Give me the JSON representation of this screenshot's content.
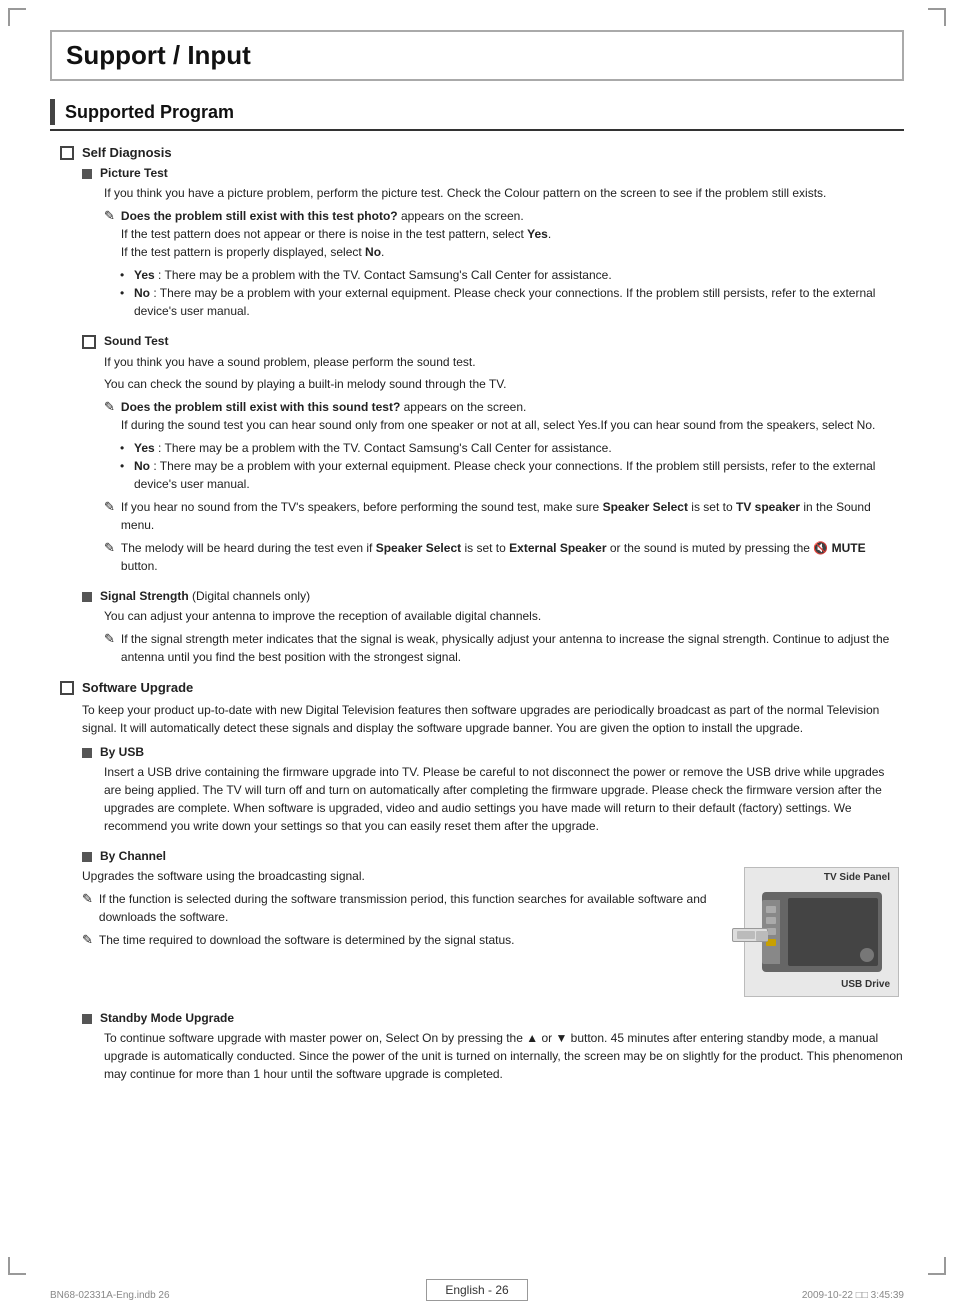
{
  "page": {
    "main_title": "Support / Input",
    "section_title": "Supported Program",
    "footer_page": "English - 26",
    "footer_left": "BN68-02331A-Eng.indb   26",
    "footer_right": "2009-10-22   □□ 3:45:39"
  },
  "self_diagnosis": {
    "heading": "Self Diagnosis",
    "picture_test": {
      "title": "Picture Test",
      "body": "If you think you have a picture problem, perform the picture test. Check the Colour pattern on the screen to see if the problem still exists.",
      "note1": {
        "bold": "Does the problem still exist with this test photo?",
        "text": " appears on the screen.\nIf the test pattern does not appear or there is noise in the test pattern, select Yes.\nIf the test pattern is properly displayed, select No."
      },
      "bullets": [
        {
          "label": "Yes",
          "text": ": There may be a problem with the TV. Contact Samsung's Call Center for assistance."
        },
        {
          "label": "No",
          "text": ": There may be a problem with your external equipment. Please check your connections. If the problem still persists, refer to the external device's user manual."
        }
      ]
    },
    "sound_test": {
      "title": "Sound Test",
      "body1": "If you think you have a sound problem, please perform the sound test.",
      "body2": "You can check the sound by playing a built-in melody sound through the TV.",
      "note1": {
        "bold": "Does the problem still exist with this sound test?",
        "text": " appears on the screen.\nIf during the sound test you can hear sound only from one speaker or not at all, select Yes.If you can hear sound from the speakers, select No."
      },
      "bullets": [
        {
          "label": "Yes",
          "text": ": There may be a problem with the TV. Contact Samsung's Call Center for assistance."
        },
        {
          "label": "No",
          "text": ": There may be a problem with your external equipment. Please check your connections. If the problem still persists, refer to the external device's user manual."
        }
      ],
      "note2": "If you hear no sound from the TV's speakers, before performing the sound test, make sure <b>Speaker Select</b> is set to <b>TV speaker</b> in the Sound menu.",
      "note3": "The melody will be heard during the test even if <b>Speaker Select</b> is set to <b>External Speaker</b> or the sound is muted by pressing the 🔇 <b>MUTE</b> button."
    },
    "signal_strength": {
      "title": "Signal Strength",
      "title_note": "(Digital channels only)",
      "body": "You can adjust your antenna to improve the reception of available digital channels.",
      "note1": "If the signal strength meter indicates that the signal is weak, physically adjust your antenna to increase the signal strength. Continue to adjust the antenna until you find the best position with the strongest signal."
    }
  },
  "software_upgrade": {
    "heading": "Software Upgrade",
    "body": "To keep your product up-to-date with new Digital Television features then software upgrades are periodically broadcast as part of the normal Television signal. It will automatically detect these signals and display the software upgrade banner. You are given the option to install the upgrade.",
    "by_usb": {
      "title": "By USB",
      "body": "Insert a USB drive containing the firmware upgrade into TV. Please be careful to not disconnect the power or remove the USB drive while upgrades are being applied. The TV will turn off and turn on automatically after completing the firmware upgrade. Please check the firmware version after the upgrades are complete. When software is upgraded, video and audio settings you have made will return to their default (factory) settings. We recommend you write down your settings so that you can easily reset them after the upgrade."
    },
    "by_channel": {
      "title": "By Channel",
      "body": "Upgrades the software using the broadcasting signal.",
      "note1": "If the function is selected during the software transmission period, this function searches for available software and downloads the software.",
      "note2": "The time required to download the software is determined by the signal status.",
      "tv_side_panel_label": "TV Side Panel",
      "usb_drive_label": "USB Drive"
    },
    "standby_mode": {
      "title": "Standby Mode Upgrade",
      "body": "To continue software upgrade with master power on, Select On by pressing the ▲ or ▼ button. 45 minutes after entering standby mode, a manual upgrade is automatically conducted. Since the power of the unit is turned on internally, the screen may be on slightly for the product. This phenomenon may continue for more than 1 hour until the software upgrade is completed."
    }
  }
}
